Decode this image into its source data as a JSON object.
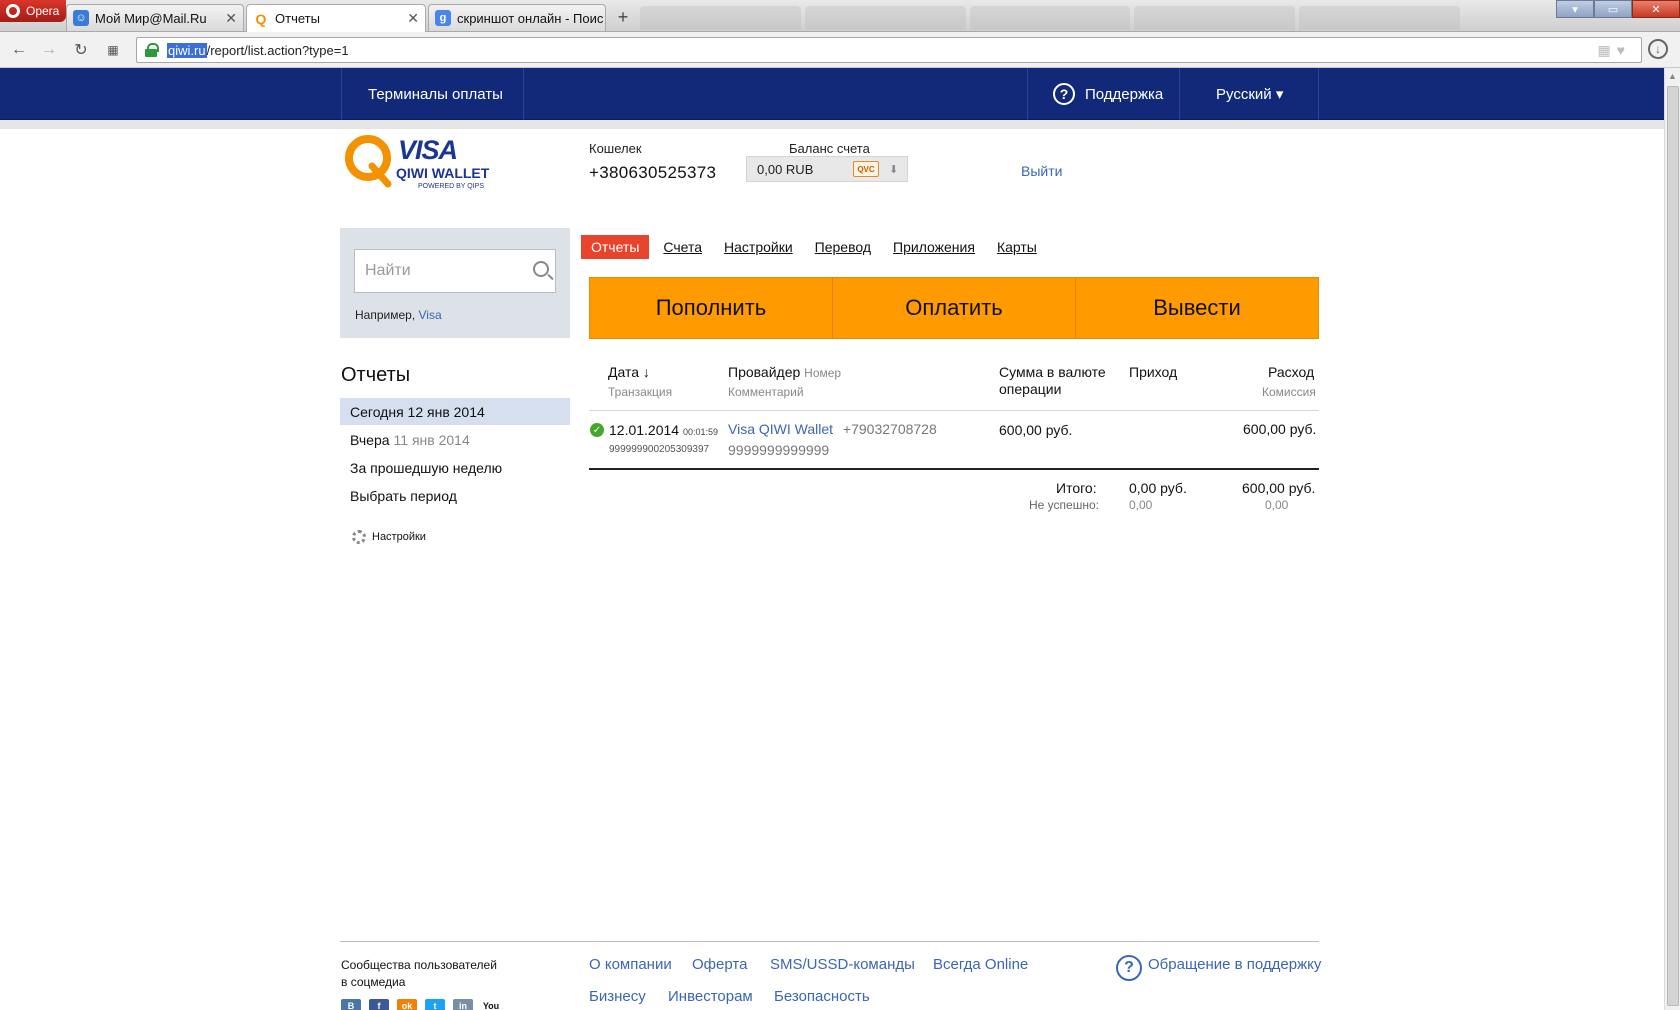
{
  "browser": {
    "opera_label": "Opera",
    "tabs": [
      {
        "title": "Мой Мир@Mail.Ru"
      },
      {
        "title": "Отчеты"
      },
      {
        "title": "скриншот онлайн - Поис"
      }
    ],
    "url_host": "qiwi.ru",
    "url_path": "/report/list.action?type=1"
  },
  "topnav": {
    "terminals": "Терминалы оплаты",
    "support": "Поддержка",
    "language": "Русский ▾"
  },
  "logo": {
    "visa": "VISA",
    "qiwi_wallet": "QIWI WALLET",
    "powered": "POWERED BY QIPS"
  },
  "account": {
    "wallet_label": "Кошелек",
    "wallet_number": "+380630525373",
    "balance_label": "Баланс счета",
    "balance_value": "0,00 RUB",
    "currency_badge": "QVC",
    "logout": "Выйти"
  },
  "sidebar": {
    "search_placeholder": "Найти",
    "example_prefix": "Например, ",
    "example_link": "Visa",
    "title": "Отчеты",
    "items": [
      {
        "label": "Сегодня",
        "date": "12 янв 2014"
      },
      {
        "label": "Вчера",
        "date": "11 янв 2014"
      },
      {
        "label": "За прошедшую неделю",
        "date": ""
      },
      {
        "label": "Выбрать период",
        "date": ""
      }
    ],
    "settings": "Настройки"
  },
  "tabs": [
    "Отчеты",
    "Счета",
    "Настройки",
    "Перевод",
    "Приложения",
    "Карты"
  ],
  "actions": [
    "Пополнить",
    "Оплатить",
    "Вывести"
  ],
  "table": {
    "headers": {
      "date": "Дата ↓",
      "transaction": "Транзакция",
      "provider": "Провайдер",
      "number": "Номер",
      "comment": "Комментарий",
      "amount_l1": "Сумма в валюте",
      "amount_l2": "операции",
      "income": "Приход",
      "expense": "Расход",
      "commission": "Комиссия"
    },
    "rows": [
      {
        "date": "12.01.2014",
        "time": "00:01:59",
        "transaction": "999999900205309397",
        "provider": "Visa QIWI Wallet",
        "number": "+79032708728",
        "comment": "9999999999999",
        "amount": "600,00 руб.",
        "income": "",
        "expense": "600,00 руб."
      }
    ],
    "totals": {
      "label": "Итого:",
      "failed_label": "Не успешно:",
      "income": "0,00 руб.",
      "income_failed": "0,00",
      "expense": "600,00 руб.",
      "expense_failed": "0,00"
    }
  },
  "footer": {
    "community_l1": "Сообщества пользователей",
    "community_l2": "в соцмедиа",
    "links_row1": [
      "О компании",
      "Оферта",
      "SMS/USSD-команды",
      "Всегда Online"
    ],
    "links_row2": [
      "Бизнесу",
      "Инвесторам",
      "Безопасность"
    ],
    "support_request": "Обращение в поддержку",
    "social": [
      "B",
      "f",
      "ok",
      "t",
      "in",
      "You"
    ]
  },
  "colors": {
    "nav_bg": "#12297a",
    "accent_orange": "#ff9b00",
    "active_tab": "#e8432c",
    "link_blue": "#3b66b3"
  }
}
